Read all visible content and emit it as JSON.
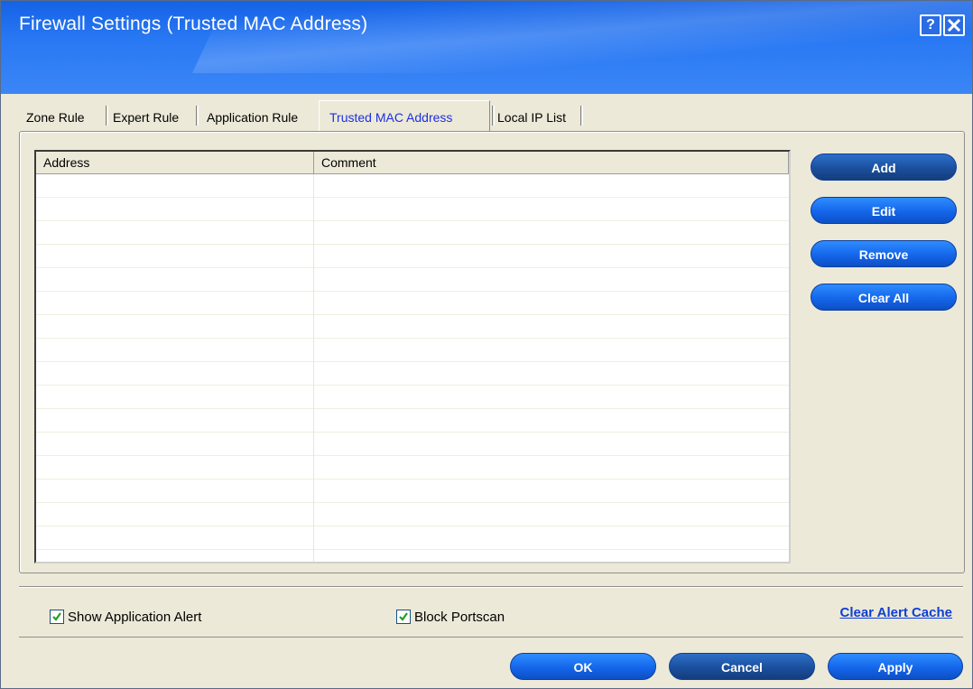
{
  "window": {
    "title": "Firewall Settings (Trusted MAC Address)",
    "help_label": "?",
    "accent_color": "#2a79f4"
  },
  "tabs": [
    {
      "label": "Zone Rule",
      "active": false
    },
    {
      "label": "Expert Rule",
      "active": false
    },
    {
      "label": "Application Rule",
      "active": false
    },
    {
      "label": "Trusted MAC Address",
      "active": true
    },
    {
      "label": "Local IP List",
      "active": false
    }
  ],
  "table": {
    "columns": [
      "Address",
      "Comment"
    ],
    "rows": []
  },
  "side_buttons": {
    "add": "Add",
    "edit": "Edit",
    "remove": "Remove",
    "clear_all": "Clear All"
  },
  "options": {
    "show_application_alert": {
      "label": "Show Application Alert",
      "checked": true
    },
    "block_portscan": {
      "label": "Block Portscan",
      "checked": true
    },
    "clear_alert_cache": "Clear Alert Cache"
  },
  "footer": {
    "ok": "OK",
    "cancel": "Cancel",
    "apply": "Apply"
  },
  "icons": {
    "help": "help-icon",
    "close": "close-icon",
    "checkbox": "checkmark-icon"
  }
}
